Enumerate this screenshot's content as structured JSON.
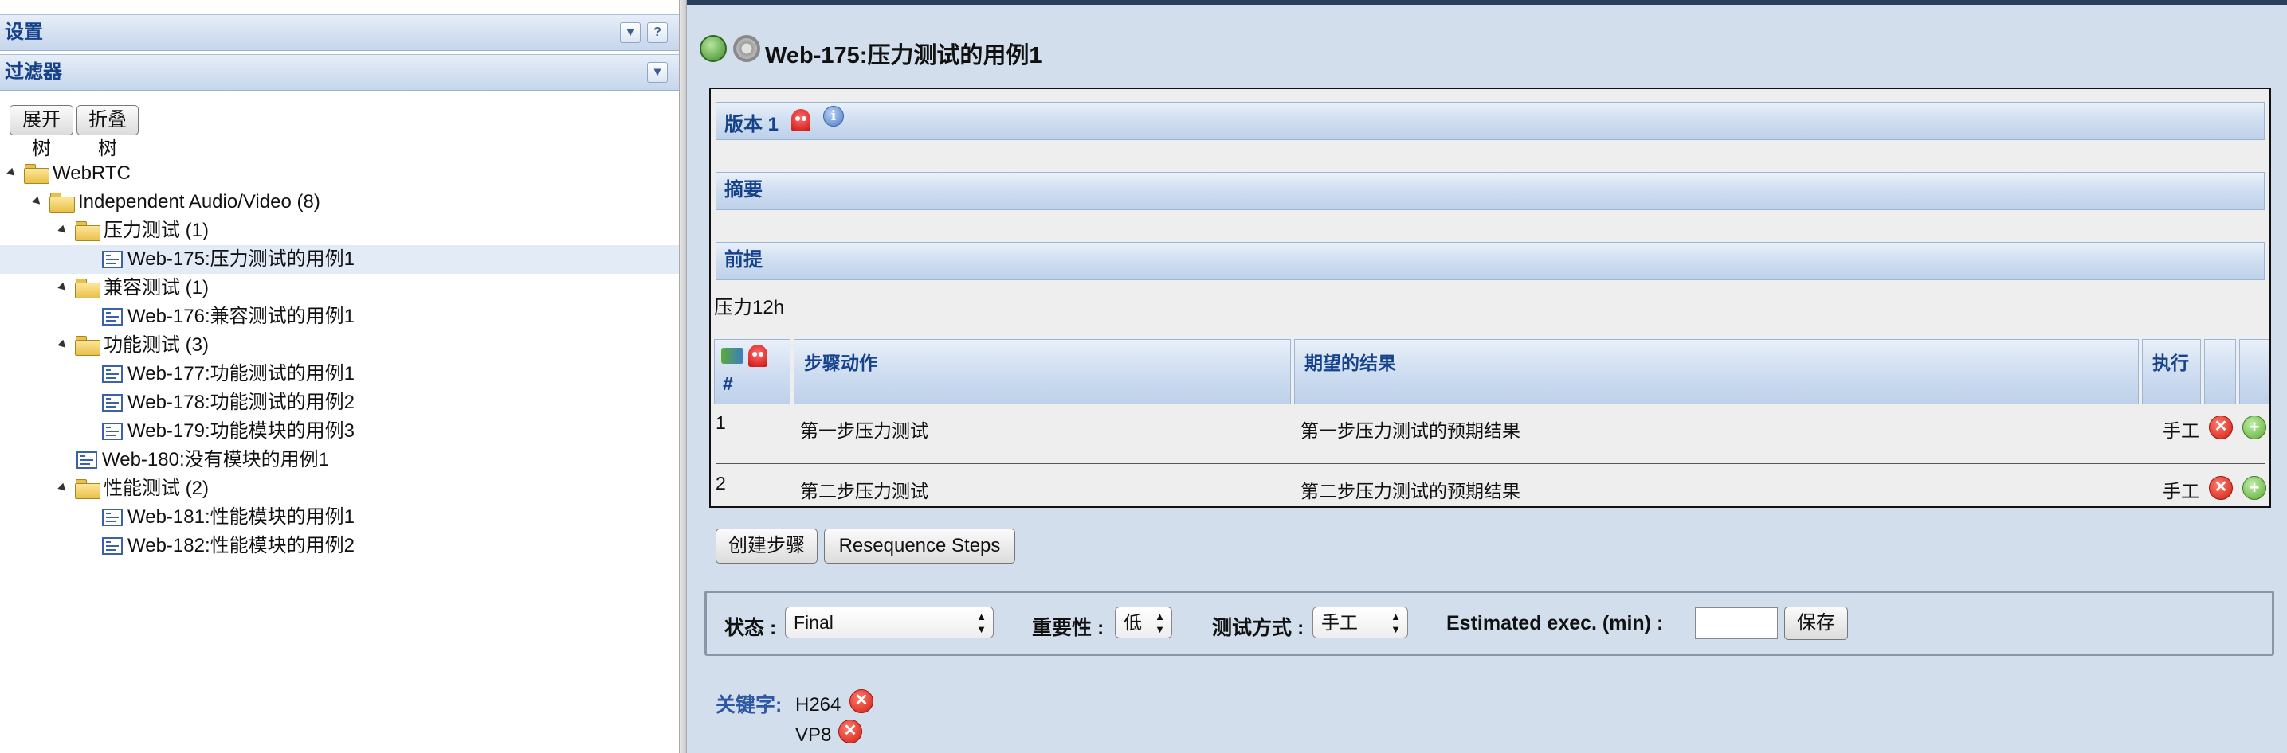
{
  "left": {
    "settings_header": "设置",
    "filters_header": "过滤器",
    "help_button": "?",
    "expand_tree_button": "展开树",
    "collapse_tree_button": "折叠树",
    "tree": [
      {
        "label": "WebRTC",
        "type": "folder",
        "level": 0,
        "selected": false
      },
      {
        "label": "Independent Audio/Video (8)",
        "type": "folder",
        "level": 1,
        "selected": false
      },
      {
        "label": "压力测试 (1)",
        "type": "folder",
        "level": 2,
        "selected": false
      },
      {
        "label": "Web-175:压力测试的用例1",
        "type": "testcase",
        "level": 3,
        "selected": true
      },
      {
        "label": "兼容测试 (1)",
        "type": "folder",
        "level": 2,
        "selected": false
      },
      {
        "label": "Web-176:兼容测试的用例1",
        "type": "testcase",
        "level": 3,
        "selected": false
      },
      {
        "label": "功能测试 (3)",
        "type": "folder",
        "level": 2,
        "selected": false
      },
      {
        "label": "Web-177:功能测试的用例1",
        "type": "testcase",
        "level": 3,
        "selected": false
      },
      {
        "label": "Web-178:功能测试的用例2",
        "type": "testcase",
        "level": 3,
        "selected": false
      },
      {
        "label": "Web-179:功能模块的用例3",
        "type": "testcase",
        "level": 3,
        "selected": false
      },
      {
        "label": "Web-180:没有模块的用例1",
        "type": "testcase",
        "level": 2,
        "selected": false
      },
      {
        "label": "性能测试 (2)",
        "type": "folder",
        "level": 2,
        "selected": false
      },
      {
        "label": "Web-181:性能模块的用例1",
        "type": "testcase",
        "level": 3,
        "selected": false
      },
      {
        "label": "Web-182:性能模块的用例2",
        "type": "testcase",
        "level": 3,
        "selected": false
      }
    ]
  },
  "testcase": {
    "title": "Web-175:压力测试的用例1",
    "version_label": "版本 1",
    "summary_label": "摘要",
    "preconditions_label": "前提",
    "preconditions_text": "压力12h",
    "steps_table": {
      "col_number": "#",
      "col_action": "步骤动作",
      "col_expected": "期望的结果",
      "col_execution": "执行",
      "rows": [
        {
          "number": "1",
          "action": "第一步压力测试",
          "expected": "第一步压力测试的预期结果",
          "execution": "手工"
        },
        {
          "number": "2",
          "action": "第二步压力测试",
          "expected": "第二步压力测试的预期结果",
          "execution": "手工"
        }
      ]
    },
    "create_step_button": "创建步骤",
    "resequence_button": "Resequence Steps",
    "status_label": "状态 :",
    "status_value": "Final",
    "importance_label": "重要性 :",
    "importance_value": "低",
    "execution_type_label": "测试方式 :",
    "execution_type_value": "手工",
    "estimated_label": "Estimated exec. (min) :",
    "estimated_value": "",
    "save_button": "保存",
    "keywords_label": "关键字:",
    "keywords": [
      "H264",
      "VP8"
    ]
  },
  "icons": {
    "delete": "delete-icon",
    "add": "add-icon",
    "ghost": "ghost-icon",
    "info": "info-icon",
    "folder": "folder-icon",
    "testcase": "testcase-icon"
  },
  "colors": {
    "header_text": "#15428b",
    "right_pane_bg": "#d2deec",
    "selected_row": "#e3ebf7",
    "keyword_label": "#2e58a6"
  }
}
